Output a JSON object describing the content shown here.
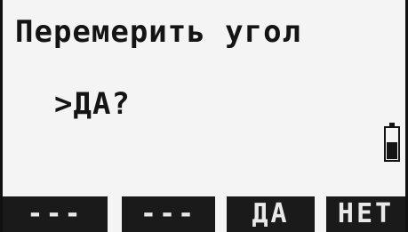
{
  "screen": {
    "title": "Перемерить угол",
    "prompt": ">ДА?",
    "battery_icon": "battery-icon"
  },
  "softkeys": {
    "f1": "---",
    "f2": "---",
    "f3": "ДА",
    "f4": "НЕТ"
  },
  "colors": {
    "lcd_background": "#f4f4f4",
    "text": "#141414",
    "softkey_background": "#1a1a1a",
    "softkey_text": "#e9e9e9"
  }
}
